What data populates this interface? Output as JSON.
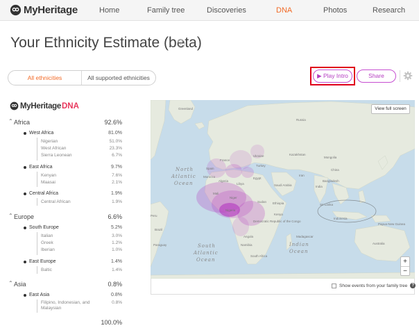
{
  "nav": {
    "logo_text": "MyHeritage",
    "items": [
      {
        "label": "Home"
      },
      {
        "label": "Family tree"
      },
      {
        "label": "Discoveries"
      },
      {
        "label": "DNA"
      },
      {
        "label": "Photos"
      },
      {
        "label": "Research"
      }
    ],
    "active": "DNA"
  },
  "page": {
    "title": "Your Ethnicity Estimate (beta)",
    "info_icon": "i"
  },
  "toggle": {
    "options": [
      "All ethnicities",
      "All supported ethnicities"
    ],
    "selected": "All ethnicities"
  },
  "actions": {
    "play_intro": "▶ Play Intro",
    "share": "Share",
    "settings_icon": "gear-icon"
  },
  "dna_logo": {
    "brand": "MyHeritage",
    "product": "DNA"
  },
  "ethnicities": [
    {
      "name": "Africa",
      "pct": "92.6%",
      "groups": [
        {
          "name": "West Africa",
          "pct": "81.0%",
          "items": [
            {
              "name": "Nigerian",
              "pct": "51.0%"
            },
            {
              "name": "West African",
              "pct": "23.3%"
            },
            {
              "name": "Sierra Leonean",
              "pct": "6.7%"
            }
          ]
        },
        {
          "name": "East Africa",
          "pct": "9.7%",
          "items": [
            {
              "name": "Kenyan",
              "pct": "7.6%"
            },
            {
              "name": "Maasai",
              "pct": "2.1%"
            }
          ]
        },
        {
          "name": "Central Africa",
          "pct": "1.9%",
          "items": [
            {
              "name": "Central African",
              "pct": "1.9%"
            }
          ]
        }
      ]
    },
    {
      "name": "Europe",
      "pct": "6.6%",
      "groups": [
        {
          "name": "South Europe",
          "pct": "5.2%",
          "items": [
            {
              "name": "Italian",
              "pct": "3.0%"
            },
            {
              "name": "Greek",
              "pct": "1.2%"
            },
            {
              "name": "Iberian",
              "pct": "1.0%"
            }
          ]
        },
        {
          "name": "East Europe",
          "pct": "1.4%",
          "items": [
            {
              "name": "Baltic",
              "pct": "1.4%"
            }
          ]
        }
      ]
    },
    {
      "name": "Asia",
      "pct": "0.8%",
      "groups": [
        {
          "name": "East Asia",
          "pct": "0.8%",
          "items": [
            {
              "name": "Filipino, Indonesian, and Malaysian",
              "pct": "0.8%"
            }
          ]
        }
      ]
    }
  ],
  "total": "100.0%",
  "map": {
    "view_full_screen": "View full screen",
    "zoom_in": "+",
    "zoom_out": "−",
    "show_events_label": "Show events from your family tree",
    "show_events_checked": false,
    "help_icon": "?",
    "labels": {
      "greenland": "Greenland",
      "north_atlantic_1": "North",
      "north_atlantic_2": "Atlantic",
      "north_atlantic_3": "Ocean",
      "south_atlantic_1": "South",
      "south_atlantic_2": "Atlantic",
      "south_atlantic_3": "Ocean",
      "indian_1": "Indian",
      "indian_2": "Ocean",
      "russia": "Russia",
      "kazakhstan": "Kazakhstan",
      "mongolia": "Mongolia",
      "china": "China",
      "india": "India",
      "brazil": "Brazil",
      "australia": "Australia",
      "indonesia": "Indonesia",
      "iran": "Iran",
      "egypt": "Egypt",
      "niger": "Niger",
      "nigeria": "Nigeria",
      "kenya": "Kenya",
      "madagascar": "Madagascar",
      "dr_congo": "Democratic Republic of the Congo",
      "saudi": "Saudi Arabia",
      "algeria": "Algeria",
      "libya": "Libya",
      "mali": "Mali",
      "turkey": "Turkey",
      "france": "France",
      "spain": "Spain",
      "ukraine": "Ukraine",
      "sudan": "Sudan",
      "ethiopia": "Ethiopia",
      "angola": "Angola",
      "namibia": "Namibia",
      "south_africa": "South Africa",
      "paraguay": "Paraguay",
      "papua": "Papua New Guinea",
      "sri_lanka": "Sri Lanka",
      "bangladesh": "Bangladesh",
      "morocco": "Morocco",
      "peru": "Peru"
    }
  },
  "colors": {
    "accent_orange": "#f26b28",
    "purple": "#b53cc0",
    "highlight_red": "#e0001a",
    "ocean": "#c7dcea",
    "land": "#e6eadf"
  }
}
